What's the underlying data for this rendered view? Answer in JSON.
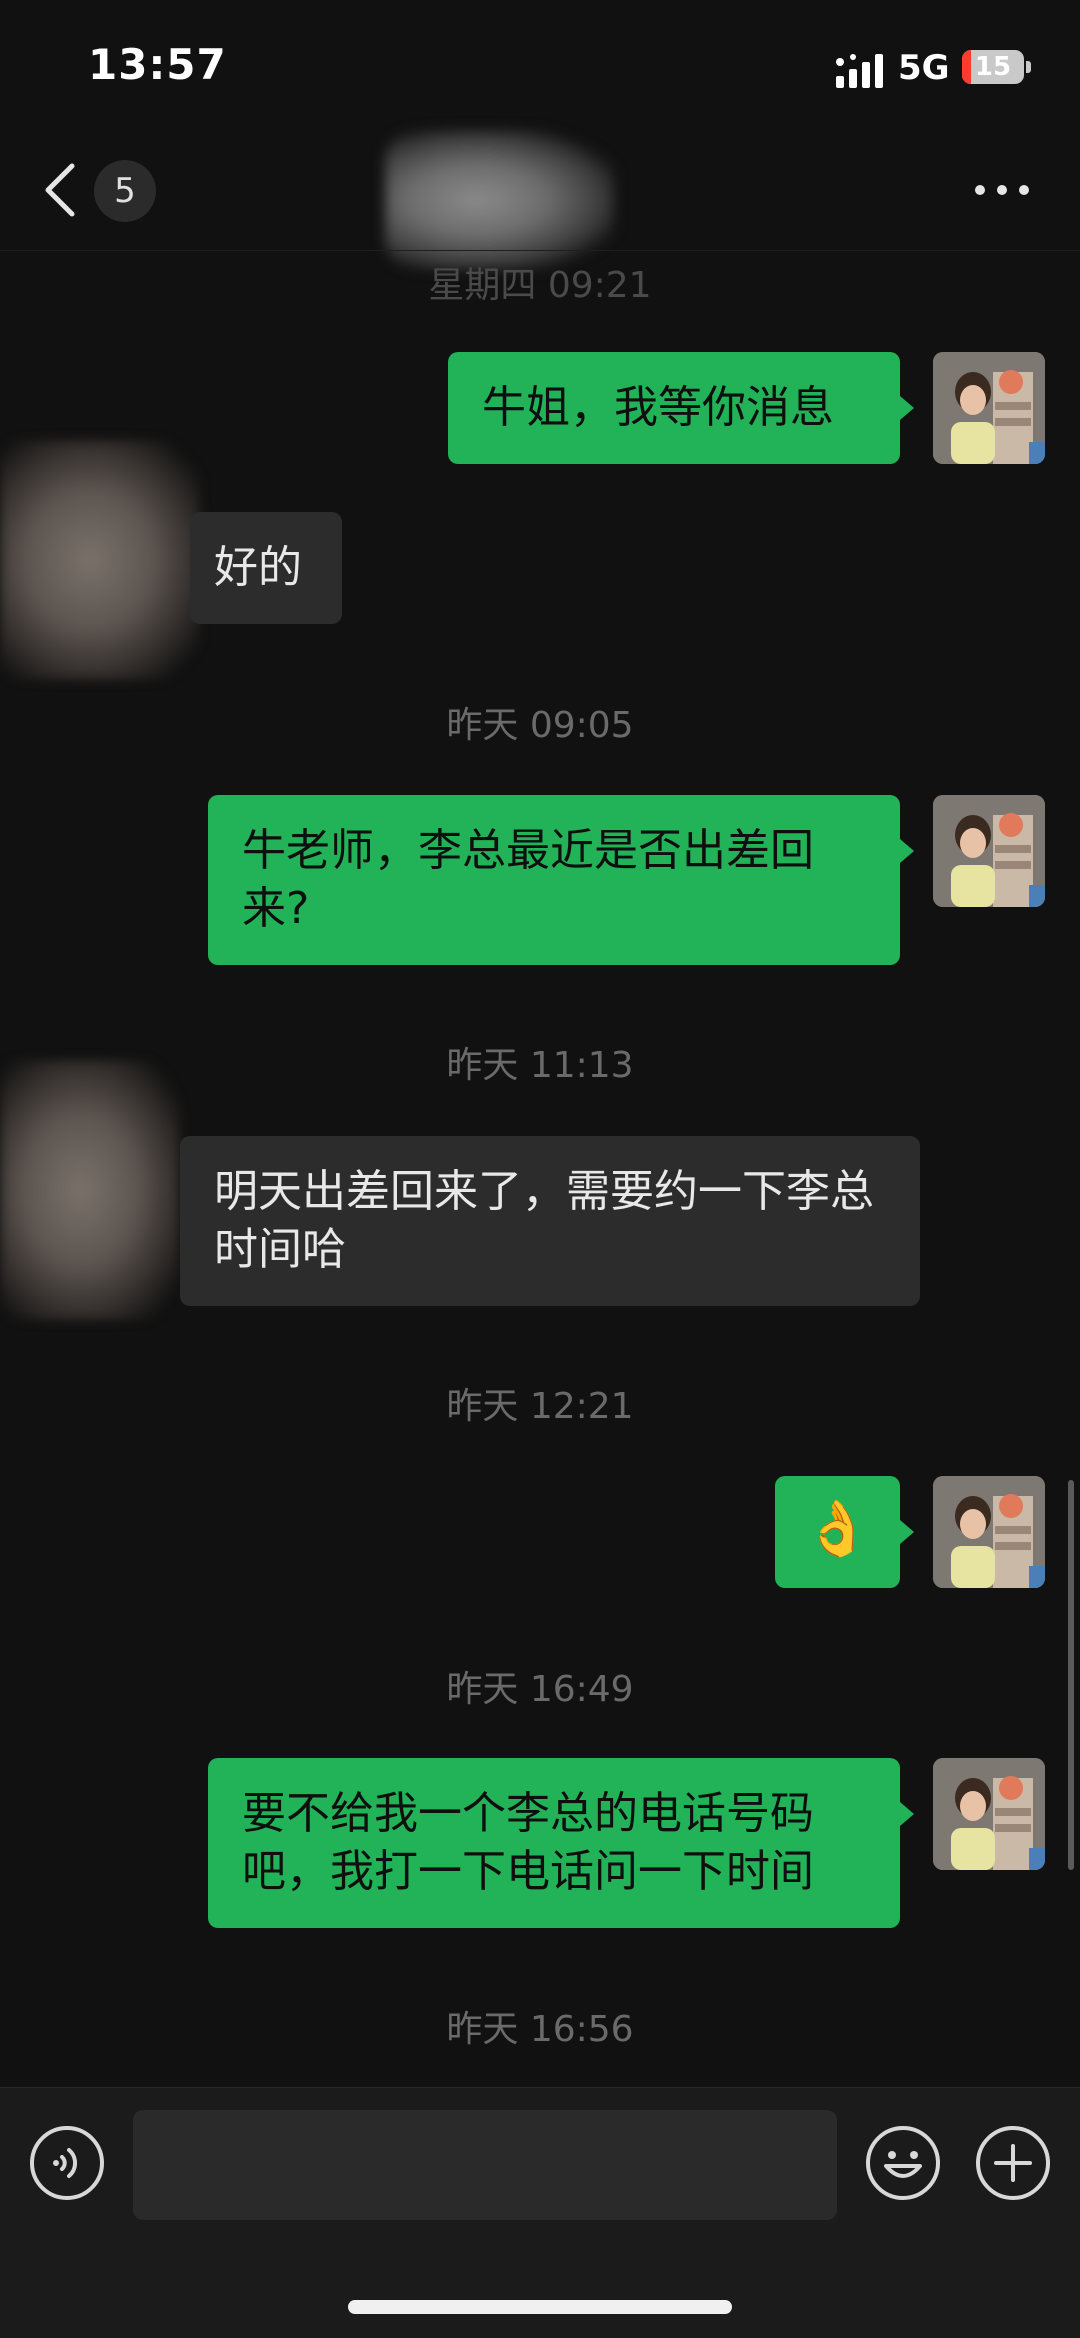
{
  "status_bar": {
    "time": "13:57",
    "network": "5G",
    "battery": "15"
  },
  "nav": {
    "unread_count": "5"
  },
  "messages": [
    {
      "from": "me",
      "text": "牛姐，我等你消息"
    },
    {
      "from": "other",
      "text": "好的"
    },
    {
      "timestamp": "昨天 09:05"
    },
    {
      "from": "me",
      "text": "牛老师，李总最近是否出差回来?"
    },
    {
      "timestamp": "昨天 11:13"
    },
    {
      "from": "other",
      "text": "明天出差回来了，需要约一下李总时间哈"
    },
    {
      "timestamp": "昨天 12:21"
    },
    {
      "from": "me",
      "text": "👌"
    },
    {
      "timestamp": "昨天 16:49"
    },
    {
      "from": "me",
      "text": "要不给我一个李总的电话号码吧，我打一下电话问一下时间"
    },
    {
      "timestamp": "昨天 16:56"
    }
  ],
  "partial_timestamp": "星期四 09:21",
  "colors": {
    "background": "#111111",
    "my_bubble": "#22b358",
    "their_bubble": "#2c2c2c",
    "timestamp_text": "#6a6a6a",
    "battery_low": "#ff3b30"
  },
  "icons": [
    "back-chevron-icon",
    "more-icon",
    "voice-icon",
    "emoji-icon",
    "plus-icon",
    "signal-icon",
    "battery-icon"
  ]
}
